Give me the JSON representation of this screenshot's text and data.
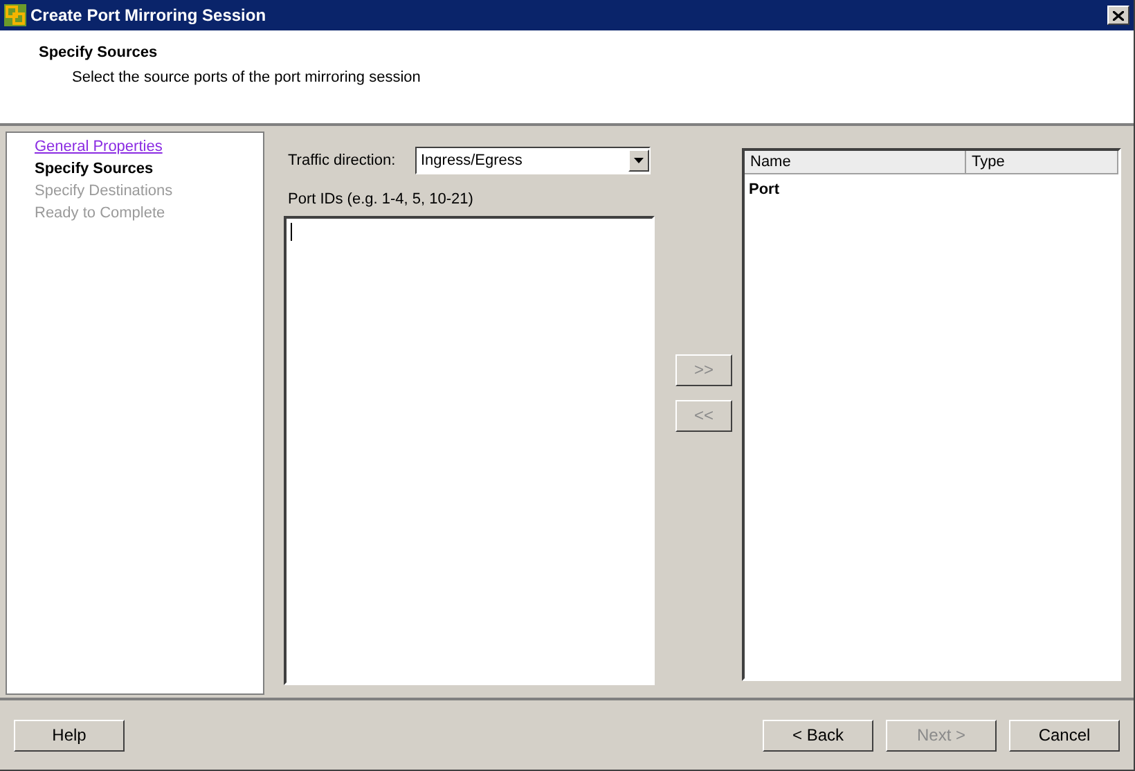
{
  "window": {
    "title": "Create Port Mirroring Session"
  },
  "header": {
    "title": "Specify Sources",
    "subtitle": "Select the source ports of the port mirroring session"
  },
  "steps": [
    {
      "label": "General Properties",
      "kind": "link"
    },
    {
      "label": "Specify Sources",
      "kind": "current"
    },
    {
      "label": "Specify Destinations",
      "kind": "pending"
    },
    {
      "label": "Ready to Complete",
      "kind": "pending"
    }
  ],
  "traffic_direction": {
    "label": "Traffic direction:",
    "value": "Ingress/Egress"
  },
  "port_ids": {
    "label": "Port IDs (e.g. 1-4, 5, 10-21)"
  },
  "move_buttons": [
    {
      "label": ">>",
      "disabled": true
    },
    {
      "label": "<<",
      "disabled": true
    }
  ],
  "table": {
    "columns": [
      "Name",
      "Type"
    ],
    "rows": [
      {
        "name": "Port",
        "kind": "group"
      }
    ]
  },
  "footer": {
    "left": [
      {
        "label": "Help",
        "disabled": false
      }
    ],
    "right": [
      {
        "label": "< Back",
        "disabled": false
      },
      {
        "label": "Next >",
        "disabled": true
      },
      {
        "label": "Cancel",
        "disabled": false
      }
    ]
  }
}
